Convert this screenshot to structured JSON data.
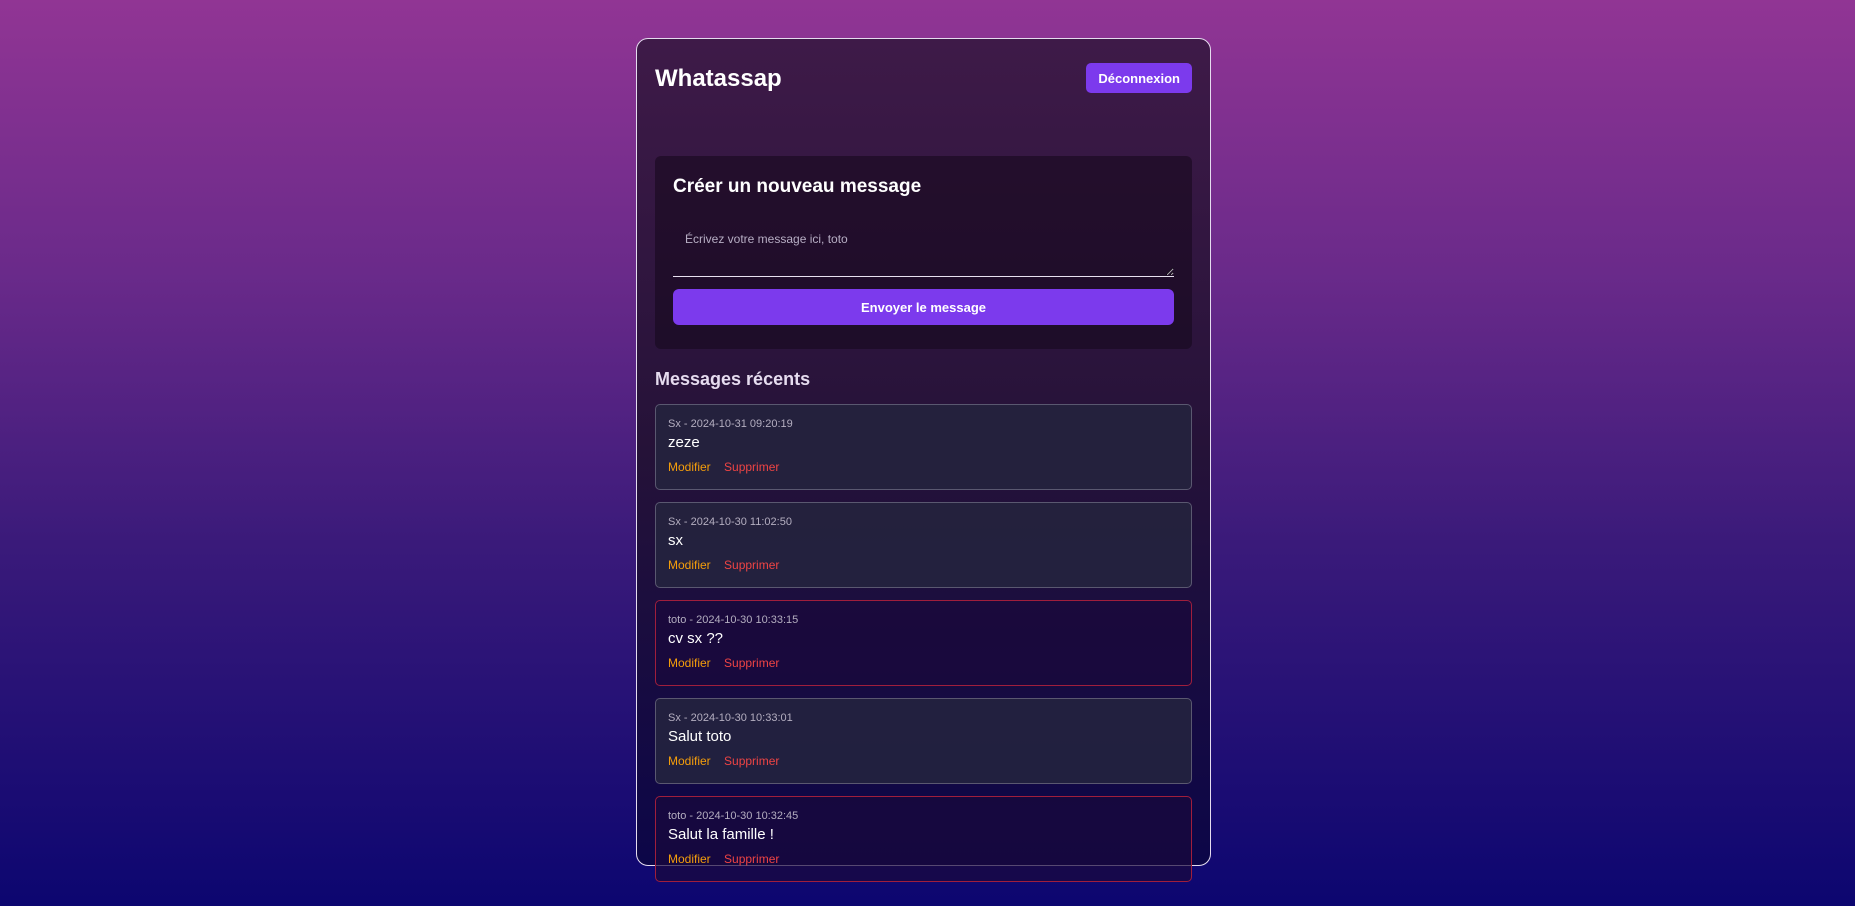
{
  "header": {
    "title": "Whatassap",
    "logout_label": "Déconnexion"
  },
  "composer": {
    "title": "Créer un nouveau message",
    "placeholder": "Écrivez votre message ici, toto",
    "value": "",
    "send_label": "Envoyer le message"
  },
  "recent": {
    "title": "Messages récents",
    "edit_label": "Modifier",
    "delete_label": "Supprimer",
    "messages": [
      {
        "author": "Sx",
        "timestamp": "2024-10-31 09:20:19",
        "meta": "Sx - 2024-10-31 09:20:19",
        "text": "zeze",
        "mine": false
      },
      {
        "author": "Sx",
        "timestamp": "2024-10-30 11:02:50",
        "meta": "Sx - 2024-10-30 11:02:50",
        "text": "sx",
        "mine": false
      },
      {
        "author": "toto",
        "timestamp": "2024-10-30 10:33:15",
        "meta": "toto - 2024-10-30 10:33:15",
        "text": "cv sx ??",
        "mine": true
      },
      {
        "author": "Sx",
        "timestamp": "2024-10-30 10:33:01",
        "meta": "Sx - 2024-10-30 10:33:01",
        "text": "Salut toto",
        "mine": false
      },
      {
        "author": "toto",
        "timestamp": "2024-10-30 10:32:45",
        "meta": "toto - 2024-10-30 10:32:45",
        "text": "Salut la famille !",
        "mine": true
      }
    ]
  },
  "colors": {
    "accent": "#7c3aed",
    "edit": "#f59e0b",
    "delete": "#ef4444",
    "own_message_border": "#a01e3c",
    "other_message_border": "#5a5870"
  }
}
